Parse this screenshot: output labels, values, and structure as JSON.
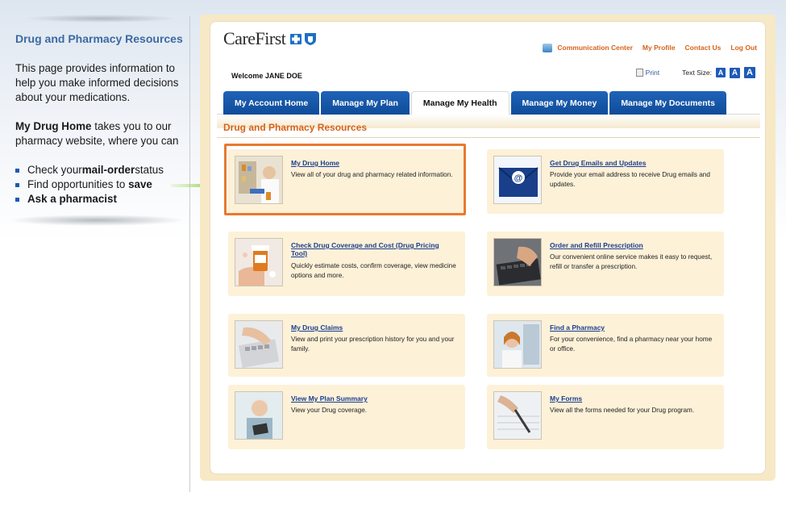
{
  "left_panel": {
    "title": "Drug and Pharmacy Resources",
    "intro": "This page provides information to help you make informed decisions about your medications.",
    "my_drug_home_bold": "My Drug Home",
    "my_drug_home_rest": " takes you to our pharmacy website, where you can",
    "bullets": [
      {
        "pre": "Check your ",
        "bold": "mail-order",
        "post": " status"
      },
      {
        "pre": "Find opportunities to ",
        "bold": "save",
        "post": ""
      },
      {
        "pre": "",
        "bold": "Ask a pharmacist",
        "post": ""
      }
    ]
  },
  "header": {
    "logo": "CareFirst",
    "links": [
      "Communication Center",
      "My Profile",
      "Contact Us",
      "Log Out"
    ],
    "welcome": "Welcome  JANE DOE",
    "print": "Print",
    "text_size_label": "Text Size:",
    "text_size_buttons": [
      "A",
      "A",
      "A"
    ]
  },
  "tabs": [
    {
      "label": "My Account Home",
      "active": false
    },
    {
      "label": "Manage My Plan",
      "active": false
    },
    {
      "label": "Manage My Health",
      "active": true
    },
    {
      "label": "Manage My Money",
      "active": false
    },
    {
      "label": "Manage My Documents",
      "active": false
    }
  ],
  "section_title": "Drug and Pharmacy Resources",
  "cards": [
    {
      "title": "My Drug Home",
      "desc": "View all of your drug and pharmacy related information.",
      "icon": "pharmacist-photo"
    },
    {
      "title": "Get Drug Emails and Updates",
      "desc": "Provide your email address to receive Drug emails and updates.",
      "icon": "email-envelope-icon"
    },
    {
      "title": "Check Drug Coverage and Cost (Drug Pricing Tool)",
      "desc": "Quickly estimate costs, confirm coverage, view medicine options and more.",
      "icon": "pill-bottle-photo"
    },
    {
      "title": "Order and Refill Prescription",
      "desc": "Our convenient online service makes it easy to request, refill or transfer a prescription.",
      "icon": "keyboard-typing-photo"
    },
    {
      "title": "My Drug Claims",
      "desc": "View and print your prescription history for you and your family.",
      "icon": "calculator-photo"
    },
    {
      "title": "Find a Pharmacy",
      "desc": "For your convenience, find a pharmacy near your home or office.",
      "icon": "pharmacist-woman-photo"
    },
    {
      "title": "View My Plan Summary",
      "desc": "View your Drug coverage.",
      "icon": "senior-woman-tablet-photo"
    },
    {
      "title": "My Forms",
      "desc": "View all the forms needed for your Drug program.",
      "icon": "pen-writing-photo"
    }
  ],
  "colors": {
    "accent_orange": "#d6631b",
    "tab_blue": "#1f63b8",
    "link_blue": "#1c3f8f",
    "card_bg": "#fdf1d8",
    "frame_bg": "#f7e9c5"
  }
}
